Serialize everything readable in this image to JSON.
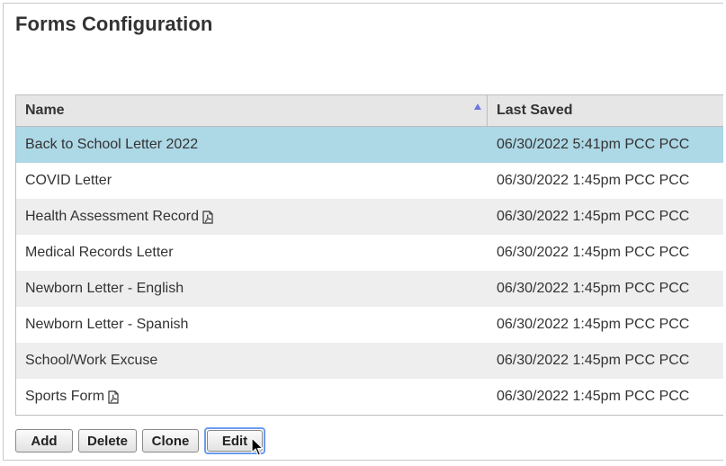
{
  "page": {
    "title": "Forms Configuration"
  },
  "grid": {
    "columns": {
      "name": "Name",
      "last_saved": "Last Saved"
    },
    "sort": {
      "column": "name",
      "direction": "ascending",
      "icon": "sort-ascending-icon"
    },
    "rows": [
      {
        "name": "Back to School Letter 2022",
        "last_saved": "06/30/2022 5:41pm PCC PCC",
        "pdf": false,
        "selected": true
      },
      {
        "name": "COVID Letter",
        "last_saved": "06/30/2022 1:45pm PCC PCC",
        "pdf": false,
        "selected": false
      },
      {
        "name": "Health Assessment Record",
        "last_saved": "06/30/2022 1:45pm PCC PCC",
        "pdf": true,
        "selected": false
      },
      {
        "name": "Medical Records Letter",
        "last_saved": "06/30/2022 1:45pm PCC PCC",
        "pdf": false,
        "selected": false
      },
      {
        "name": "Newborn Letter - English",
        "last_saved": "06/30/2022 1:45pm PCC PCC",
        "pdf": false,
        "selected": false
      },
      {
        "name": "Newborn Letter - Spanish",
        "last_saved": "06/30/2022 1:45pm PCC PCC",
        "pdf": false,
        "selected": false
      },
      {
        "name": "School/Work Excuse",
        "last_saved": "06/30/2022 1:45pm PCC PCC",
        "pdf": false,
        "selected": false
      },
      {
        "name": "Sports Form",
        "last_saved": "06/30/2022 1:45pm PCC PCC",
        "pdf": true,
        "selected": false
      }
    ]
  },
  "toolbar": {
    "add_label": "Add",
    "delete_label": "Delete",
    "clone_label": "Clone",
    "edit_label": "Edit"
  },
  "colors": {
    "selected_row": "#add8e6",
    "alt_row": "#eeeeee",
    "header_bg": "#e6e6e6",
    "focus_ring": "#6a9bef",
    "sort_icon": "#6a79e0"
  }
}
